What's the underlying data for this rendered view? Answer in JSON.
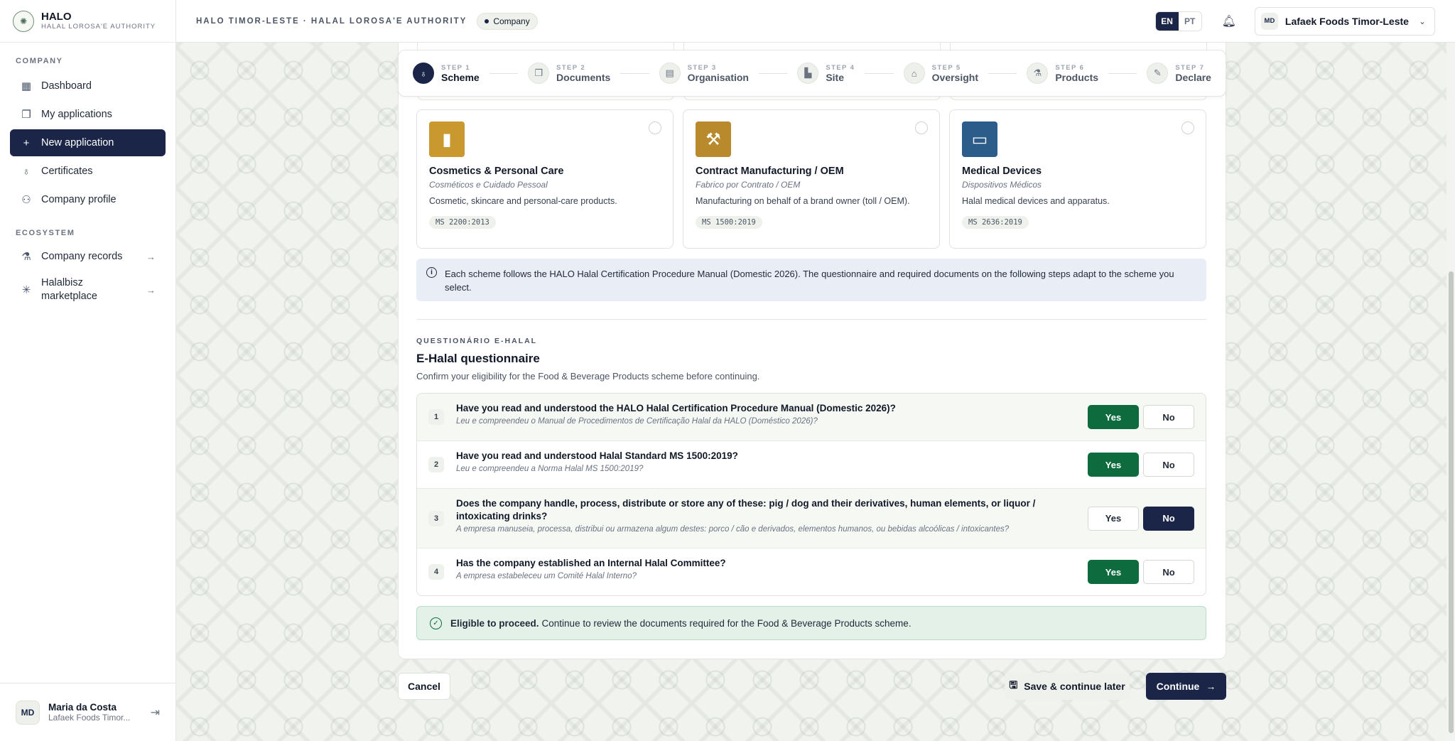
{
  "brand": {
    "name": "HALO",
    "sub": "HALAL LOROSA'E AUTHORITY"
  },
  "sidebar": {
    "section_company": "COMPANY",
    "section_ecosystem": "ECOSYSTEM",
    "items": [
      {
        "label": "Dashboard",
        "icon": "grid-icon"
      },
      {
        "label": "My applications",
        "icon": "copy-icon"
      },
      {
        "label": "New application",
        "icon": "plus-icon"
      },
      {
        "label": "Certificates",
        "icon": "award-icon"
      },
      {
        "label": "Company profile",
        "icon": "user-icon"
      }
    ],
    "eco_items": [
      {
        "label": "Company records",
        "icon": "flask-icon"
      },
      {
        "label": "Halalbisz marketplace",
        "icon": "sparkle-icon"
      }
    ],
    "user": {
      "initials": "MD",
      "name": "Maria da Costa",
      "org": "Lafaek Foods Timor..."
    }
  },
  "header": {
    "title": "HALO TIMOR-LESTE · HALAL LOROSA'E AUTHORITY",
    "chip": "Company",
    "lang_en": "EN",
    "lang_pt": "PT",
    "company_initials": "MD",
    "company_name": "Lafaek Foods Timor-Leste"
  },
  "stepper": [
    {
      "num": "STEP 1",
      "name": "Scheme",
      "active": true
    },
    {
      "num": "STEP 2",
      "name": "Documents"
    },
    {
      "num": "STEP 3",
      "name": "Organisation"
    },
    {
      "num": "STEP 4",
      "name": "Site"
    },
    {
      "num": "STEP 5",
      "name": "Oversight"
    },
    {
      "num": "STEP 6",
      "name": "Products"
    },
    {
      "num": "STEP 7",
      "name": "Declare"
    }
  ],
  "schemes": [
    {
      "name": "Cosmetics & Personal Care",
      "pt": "Cosméticos e Cuidado Pessoal",
      "desc": "Cosmetic, skincare and personal-care products.",
      "std": "MS 2200:2013",
      "color": "#c9982f"
    },
    {
      "name": "Contract Manufacturing / OEM",
      "pt": "Fabrico por Contrato / OEM",
      "desc": "Manufacturing on behalf of a brand owner (toll / OEM).",
      "std": "MS 1500:2019",
      "color": "#b88a2c"
    },
    {
      "name": "Medical Devices",
      "pt": "Dispositivos Médicos",
      "desc": "Halal medical devices and apparatus.",
      "std": "MS 2636:2019",
      "color": "#2b5c8a"
    }
  ],
  "info": "Each scheme follows the HALO Halal Certification Procedure Manual (Domestic 2026). The questionnaire and required documents on the following steps adapt to the scheme you select.",
  "questionnaire": {
    "eyebrow": "QUESTIONÁRIO E-HALAL",
    "title": "E-Halal questionnaire",
    "subtitle": "Confirm your eligibility for the Food & Beverage Products scheme before continuing.",
    "yes": "Yes",
    "no": "No",
    "questions": [
      {
        "n": "1",
        "en": "Have you read and understood the HALO Halal Certification Procedure Manual (Domestic 2026)?",
        "pt": "Leu e compreendeu o Manual de Procedimentos de Certificação Halal da HALO (Doméstico 2026)?",
        "answer": "yes"
      },
      {
        "n": "2",
        "en": "Have you read and understood Halal Standard MS 1500:2019?",
        "pt": "Leu e compreendeu a Norma Halal MS 1500:2019?",
        "answer": "yes"
      },
      {
        "n": "3",
        "en": "Does the company handle, process, distribute or store any of these: pig / dog and their derivatives, human elements, or liquor / intoxicating drinks?",
        "pt": "A empresa manuseia, processa, distribui ou armazena algum destes: porco / cão e derivados, elementos humanos, ou bebidas alcoólicas / intoxicantes?",
        "answer": "no"
      },
      {
        "n": "4",
        "en": "Has the company established an Internal Halal Committee?",
        "pt": "A empresa estabeleceu um Comité Halal Interno?",
        "answer": "yes"
      }
    ]
  },
  "eligible": {
    "bold": "Eligible to proceed.",
    "text": "Continue to review the documents required for the Food & Beverage Products scheme."
  },
  "actions": {
    "cancel": "Cancel",
    "save": "Save & continue later",
    "continue": "Continue"
  }
}
